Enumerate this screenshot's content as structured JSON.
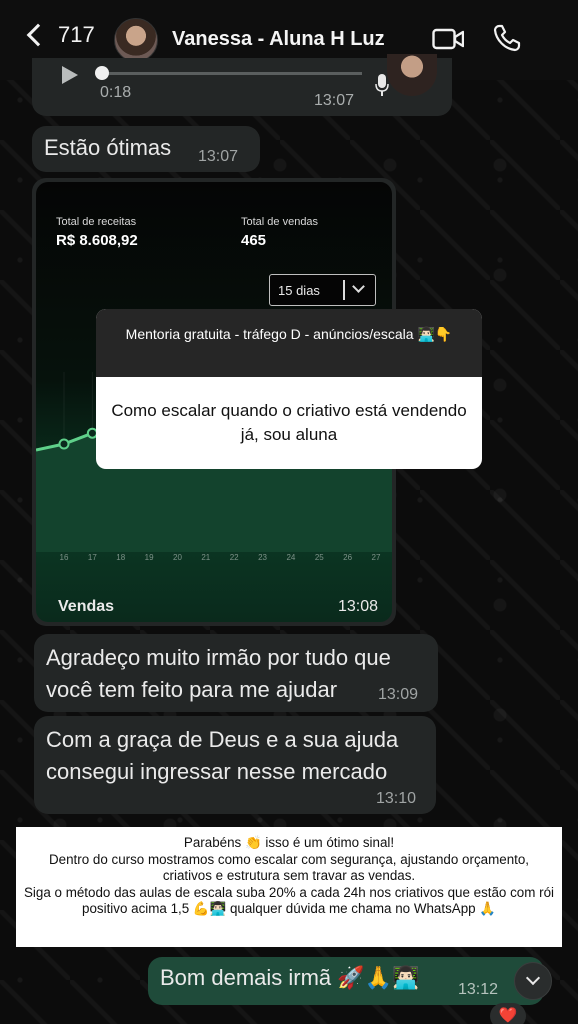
{
  "header": {
    "back_count": "717",
    "contact_name": "Vanessa  - Aluna H Luz"
  },
  "audio_message": {
    "duration": "0:18",
    "time": "13:07"
  },
  "messages": [
    {
      "text": "Estão ótimas",
      "time": "13:07"
    },
    {
      "text": "Agradeço muito irmão por tudo que\nvocê tem feito para me ajudar",
      "time": "13:09"
    },
    {
      "text": "Com a graça de Deus e a sua ajuda\nconsegui ingressar nesse mercado",
      "time": "13:10"
    }
  ],
  "image_message": {
    "total_receitas_label": "Total de receitas",
    "total_receitas_value": "R$ 8.608,92",
    "total_vendas_label": "Total de vendas",
    "total_vendas_value": "465",
    "period_select": "15 dias",
    "caption": "Vendas",
    "time": "13:08",
    "question_title": "Mentoria gratuita - tráfego D - anúncios/escala 👨🏻‍💻👇",
    "question_answer": "Como escalar quando o criativo está vendendo já, sou aluna"
  },
  "chart_data": {
    "type": "area",
    "x": [
      "16",
      "17",
      "18",
      "19",
      "20",
      "21",
      "22",
      "23",
      "24",
      "25",
      "26",
      "27"
    ],
    "series": [
      {
        "values": [
          60,
          66,
          72,
          74,
          74,
          74,
          74,
          74,
          74,
          74,
          74,
          74
        ]
      }
    ],
    "ylim": [
      0,
      100
    ],
    "color": "#5fd08a",
    "fill": "#13432d"
  },
  "reply_overlay": {
    "text": "Parabéns 👏 isso é um ótimo sinal!\nDentro do curso mostramos como escalar com segurança, ajustando orçamento, criativos e estrutura sem travar as vendas.\nSiga o método das aulas de escala suba 20% a cada 24h nos criativos que estão com rói positivo acima 1,5 💪👨🏻‍💻 qualquer dúvida me chama no WhatsApp 🙏"
  },
  "outgoing_message": {
    "text": "Bom demais irmã 🚀🙏👨🏻‍💻",
    "time": "13:12"
  },
  "reaction": "❤️",
  "colors": {
    "incoming_bubble": "#232626",
    "outgoing_bubble": "#1f4b3a",
    "chart_line": "#5fd08a"
  }
}
